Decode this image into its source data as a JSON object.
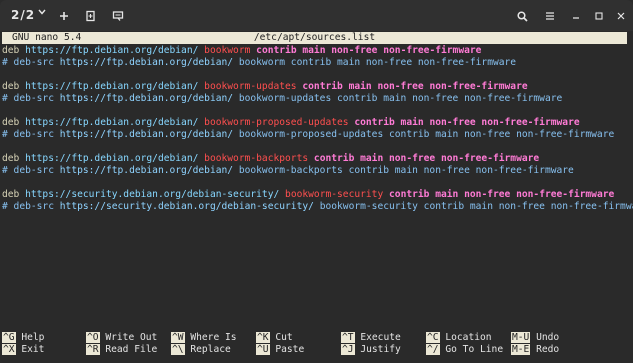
{
  "titlebar": {
    "tab_counter": "2/2",
    "icons": [
      "chevron-down-icon",
      "plus-icon",
      "split-pane-icon",
      "broadcast-icon",
      "search-icon",
      "menu-icon",
      "minimize-icon",
      "maximize-icon",
      "close-icon"
    ]
  },
  "nano": {
    "version": "GNU nano 5.4",
    "filename": "/etc/apt/sources.list"
  },
  "lines": [
    [
      {
        "t": "deb ",
        "c": "c-deb"
      },
      {
        "t": "https://ftp.debian.org/debian/",
        "c": "c-url"
      },
      {
        "t": " "
      },
      {
        "t": "bookworm",
        "c": "c-suite"
      },
      {
        "t": " contrib main non-free non-free-firmware",
        "c": "c-comp"
      }
    ],
    [
      {
        "t": "# deb-src ",
        "c": "c-comment"
      },
      {
        "t": "https://ftp.debian.org/debian/",
        "c": "c-comment url"
      },
      {
        "t": " bookworm contrib main non-free non-free-firmware",
        "c": "c-comment"
      }
    ],
    [],
    [
      {
        "t": "deb ",
        "c": "c-deb"
      },
      {
        "t": "https://ftp.debian.org/debian/",
        "c": "c-url"
      },
      {
        "t": " "
      },
      {
        "t": "bookworm-updates",
        "c": "c-suite"
      },
      {
        "t": " contrib main non-free non-free-firmware",
        "c": "c-comp"
      }
    ],
    [
      {
        "t": "# deb-src ",
        "c": "c-comment"
      },
      {
        "t": "https://ftp.debian.org/debian/",
        "c": "c-comment url"
      },
      {
        "t": " bookworm-updates contrib main non-free non-free-firmware",
        "c": "c-comment"
      }
    ],
    [],
    [
      {
        "t": "deb ",
        "c": "c-deb"
      },
      {
        "t": "https://ftp.debian.org/debian/",
        "c": "c-url"
      },
      {
        "t": " "
      },
      {
        "t": "bookworm-proposed-updates",
        "c": "c-suite"
      },
      {
        "t": " contrib main non-free non-free-firmware",
        "c": "c-comp"
      }
    ],
    [
      {
        "t": "# deb-src ",
        "c": "c-comment"
      },
      {
        "t": "https://ftp.debian.org/debian/",
        "c": "c-comment url"
      },
      {
        "t": " bookworm-proposed-updates contrib main non-free non-free-firmware",
        "c": "c-comment"
      }
    ],
    [],
    [
      {
        "t": "deb ",
        "c": "c-deb"
      },
      {
        "t": "https://ftp.debian.org/debian/",
        "c": "c-url"
      },
      {
        "t": " "
      },
      {
        "t": "bookworm-backports",
        "c": "c-suite"
      },
      {
        "t": " contrib main non-free non-free-firmware",
        "c": "c-comp"
      }
    ],
    [
      {
        "t": "# deb-src ",
        "c": "c-comment"
      },
      {
        "t": "https://ftp.debian.org/debian/",
        "c": "c-comment url"
      },
      {
        "t": " bookworm-backports contrib main non-free non-free-firmware",
        "c": "c-comment"
      }
    ],
    [],
    [
      {
        "t": "deb ",
        "c": "c-deb"
      },
      {
        "t": "https://security.debian.org/debian-security/",
        "c": "c-url"
      },
      {
        "t": " "
      },
      {
        "t": "bookworm-security",
        "c": "c-suite"
      },
      {
        "t": " contrib main non-free non-free-firmware",
        "c": "c-comp"
      }
    ],
    [
      {
        "t": "# deb-src ",
        "c": "c-comment"
      },
      {
        "t": "https://security.debian.org/debian-security/",
        "c": "c-comment url"
      },
      {
        "t": " bookworm-security contrib main non-free non-free-firmware",
        "c": "c-comment"
      }
    ]
  ],
  "shortcuts": [
    [
      {
        "key": "^G",
        "label": "Help"
      },
      {
        "key": "^O",
        "label": "Write Out"
      },
      {
        "key": "^W",
        "label": "Where Is"
      },
      {
        "key": "^K",
        "label": "Cut"
      },
      {
        "key": "^T",
        "label": "Execute"
      },
      {
        "key": "^C",
        "label": "Location"
      },
      {
        "key": "M-U",
        "label": "Undo"
      }
    ],
    [
      {
        "key": "^X",
        "label": "Exit"
      },
      {
        "key": "^R",
        "label": "Read File"
      },
      {
        "key": "^\\",
        "label": "Replace"
      },
      {
        "key": "^U",
        "label": "Paste"
      },
      {
        "key": "^J",
        "label": "Justify"
      },
      {
        "key": "^/",
        "label": "Go To Line"
      },
      {
        "key": "M-E",
        "label": "Redo"
      }
    ]
  ],
  "colors": {
    "terminal_bg": "#2a2a2a",
    "header_bg": "#ece8d6",
    "url": "#87d7ff",
    "suite": "#ff4f4f",
    "components": "#ff7bd5",
    "comment": "#87c0ef"
  }
}
